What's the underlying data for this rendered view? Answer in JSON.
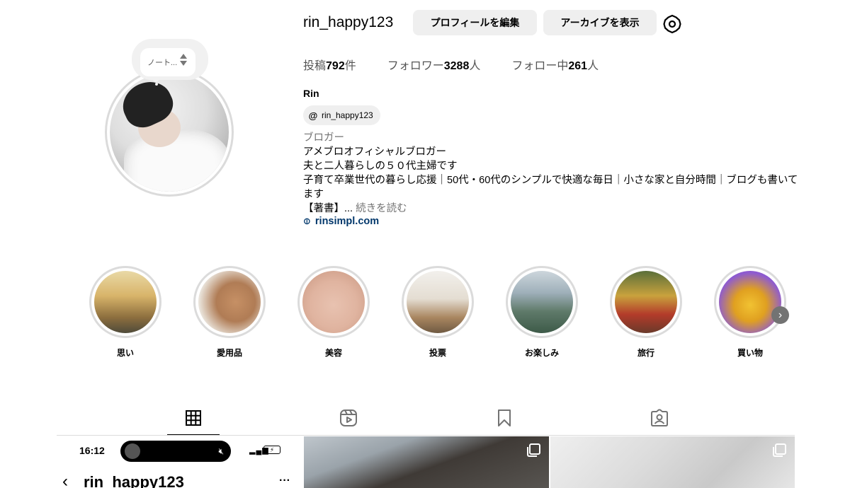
{
  "profile": {
    "username": "rin_happy123",
    "edit_profile_label": "プロフィールを編集",
    "view_archive_label": "アーカイブを表示",
    "note_text": "ノート...",
    "stats": {
      "posts_label": "投稿",
      "posts_count": "792",
      "posts_unit": "件",
      "followers_label": "フォロワー",
      "followers_count": "3288",
      "followers_unit": "人",
      "following_label": "フォロー中",
      "following_count": "261",
      "following_unit": "人"
    },
    "full_name": "Rin",
    "threads_handle": "rin_happy123",
    "category": "ブロガー",
    "bio_lines": [
      "アメブロオフィシャルブロガー",
      "夫と二人暮らしの５０代主婦です",
      "子育て卒業世代の暮らし応援｜50代・60代のシンプルで快適な毎日｜小さな家と自分時間｜ブログも書いてます",
      "【著書】..."
    ],
    "read_more": "続きを読む",
    "website": "rinsimpl.com"
  },
  "highlights": [
    {
      "label": "思い"
    },
    {
      "label": "愛用品"
    },
    {
      "label": "美容"
    },
    {
      "label": "投票"
    },
    {
      "label": "お楽しみ"
    },
    {
      "label": "旅行"
    },
    {
      "label": "買い物"
    }
  ],
  "tabs": [
    "posts-grid",
    "reels",
    "saved",
    "tagged"
  ],
  "posts": {
    "phone_time": "16:12",
    "phone_username": "rin_happy123",
    "phone_more": "···"
  },
  "icons": {
    "settings": "gear-icon",
    "threads": "threads-icon",
    "link": "link-icon",
    "next": "chevron-right-icon"
  },
  "colors": {
    "button_bg": "#efefef",
    "link": "#00376b",
    "secondary_text": "#737373",
    "ring": "#dbdbdb"
  }
}
